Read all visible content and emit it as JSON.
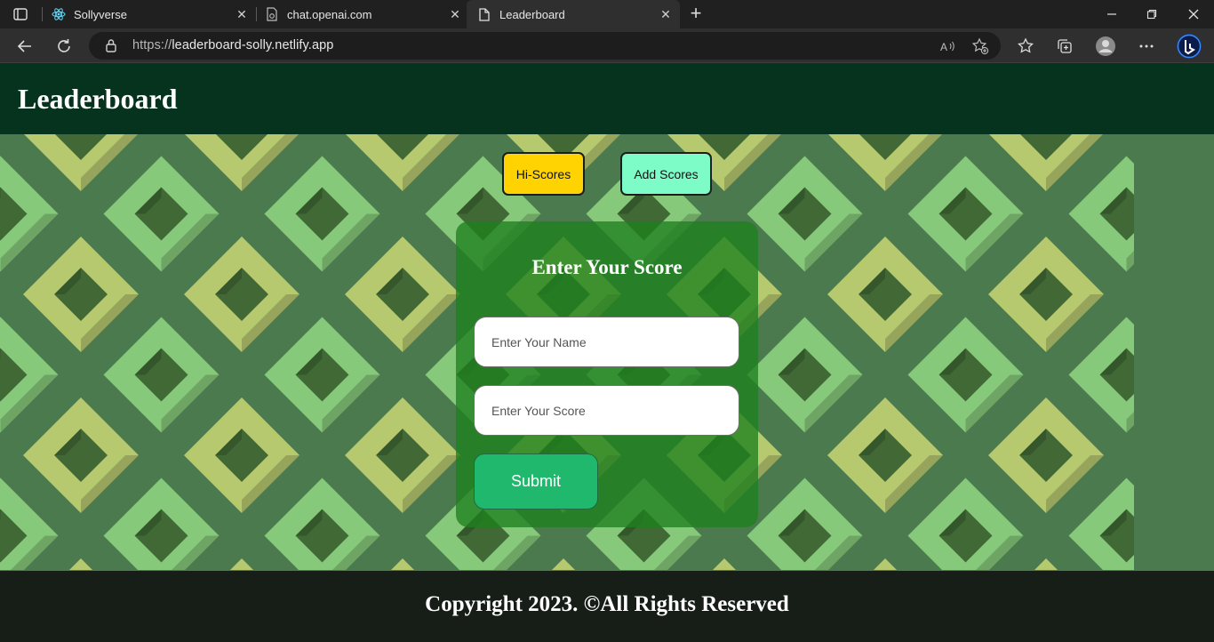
{
  "browser": {
    "tabs": [
      {
        "title": "Sollyverse",
        "icon": "react-icon",
        "active": false
      },
      {
        "title": "chat.openai.com",
        "icon": "page-icon",
        "active": false
      },
      {
        "title": "Leaderboard",
        "icon": "document-icon",
        "active": true
      }
    ],
    "url_prefix": "https://",
    "url_host": "leaderboard-solly.netlify.app"
  },
  "site": {
    "title": "Leaderboard",
    "nav": {
      "hi_scores": "Hi-Scores",
      "add_scores": "Add Scores"
    },
    "form": {
      "title": "Enter Your Score",
      "name_placeholder": "Enter Your Name",
      "score_placeholder": "Enter Your Score",
      "submit_label": "Submit"
    },
    "footer": "Copyright 2023. ©All Rights Reserved"
  },
  "colors": {
    "header_bg": "#05331d",
    "hi_scores_button": "#ffd302",
    "add_scores_button": "#7dfcc7",
    "form_card": "#1d801e",
    "submit_button": "#20b86d"
  }
}
